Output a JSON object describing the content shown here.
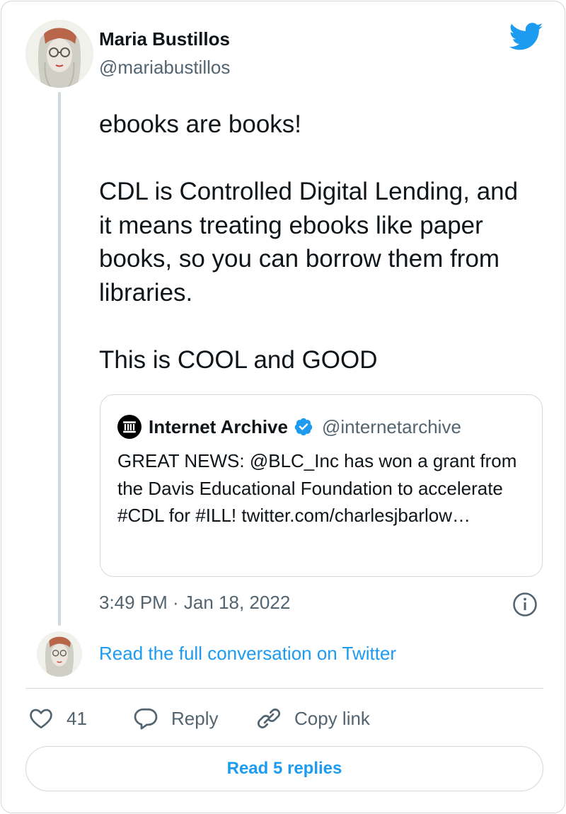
{
  "author": {
    "name": "Maria Bustillos",
    "handle": "@mariabustillos"
  },
  "tweet": {
    "paragraphs": [
      "ebooks are books!",
      "CDL is Controlled Digital Lending, and it means treating ebooks like paper books, so you can borrow them from libraries.",
      "This is COOL and GOOD"
    ],
    "timestamp": "3:49 PM · Jan 18, 2022"
  },
  "quoted_tweet": {
    "name": "Internet Archive",
    "handle": "@internetarchive",
    "verified": true,
    "text": "GREAT NEWS: @BLC_Inc has won a grant from the Davis Educational Foundation to accelerate #CDL for #ILL! twitter.com/charlesjbarlow…"
  },
  "conversation_link": "Read the full conversation on Twitter",
  "actions": {
    "like_count": "41",
    "reply_label": "Reply",
    "copy_label": "Copy link"
  },
  "read_replies_label": "Read 5 replies",
  "colors": {
    "brand_blue": "#1d9bf0",
    "text_primary": "#0f1419",
    "text_secondary": "#536471",
    "border": "#cfd9de"
  },
  "icons": {
    "brand": "twitter-bird-icon",
    "verified": "verified-badge-icon",
    "info": "info-icon",
    "like": "heart-icon",
    "reply": "speech-bubble-icon",
    "copy": "link-icon"
  }
}
